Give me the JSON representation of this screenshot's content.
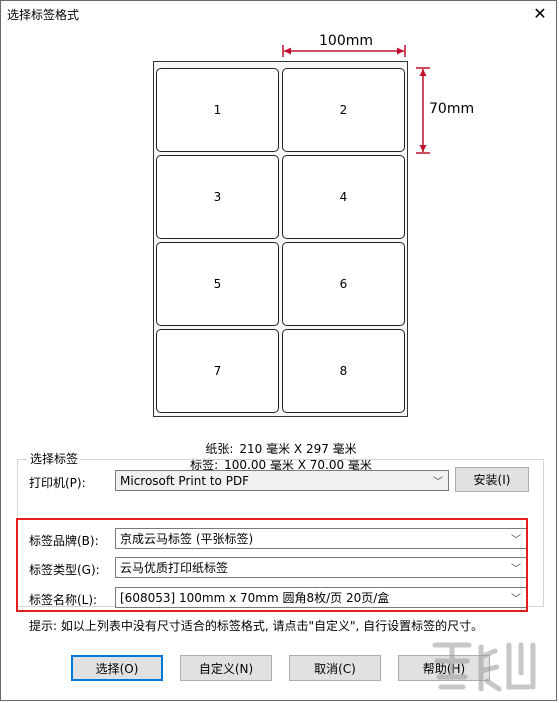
{
  "window": {
    "title": "选择标签格式",
    "close_glyph": "✕"
  },
  "preview": {
    "width_dim": "100mm",
    "height_dim": "70mm",
    "labels": [
      "1",
      "2",
      "3",
      "4",
      "5",
      "6",
      "7",
      "8"
    ],
    "paper_label": "纸张:",
    "paper_value": "210 毫米 X 297 毫米",
    "tag_label": "标签:",
    "tag_value": "100.00 毫米 X 70.00 毫米"
  },
  "group": {
    "title": "选择标签",
    "printer_label": "打印机(P):",
    "printer_value": "Microsoft Print to PDF",
    "install_button": "安装(I)",
    "brand_label": "标签品牌(B):",
    "brand_value": "京成云马标签 (平张标签)",
    "type_label": "标签类型(G):",
    "type_value": "云马优质打印纸标签",
    "name_label": "标签名称(L):",
    "name_value": "[608053] 100mm x 70mm 圆角8枚/页 20页/盒"
  },
  "hint": "提示: 如以上列表中没有尺寸适合的标签格式, 请点击\"自定义\", 自行设置标签的尺寸。",
  "buttons": {
    "select": "选择(O)",
    "custom": "自定义(N)",
    "cancel": "取消(C)",
    "help": "帮助(H)"
  },
  "colors": {
    "highlight": "#e02020",
    "dimension": "#c0102a",
    "focus": "#0078d7"
  }
}
